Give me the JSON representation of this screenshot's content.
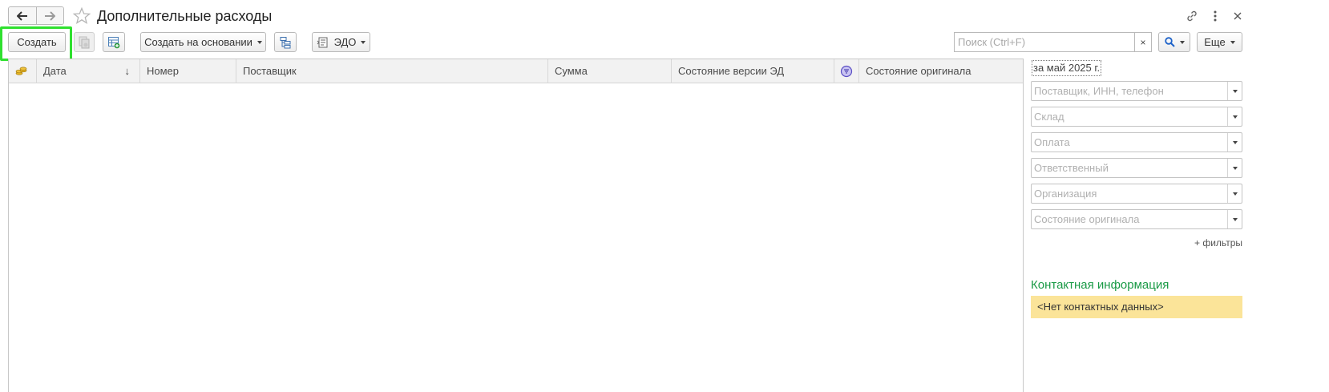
{
  "window": {
    "title": "Дополнительные расходы"
  },
  "toolbar": {
    "create_label": "Создать",
    "create_based_label": "Создать на основании",
    "edo_label": "ЭДО",
    "search_placeholder": "Поиск (Ctrl+F)",
    "search_clear": "×",
    "more_label": "Еще"
  },
  "table": {
    "columns": [
      "Дата",
      "Номер",
      "Поставщик",
      "Сумма",
      "Состояние версии ЭД",
      "Состояние оригинала"
    ],
    "sort_indicator": "↓",
    "rows": []
  },
  "panel": {
    "period": "за май 2025 г.",
    "filters": [
      {
        "placeholder": "Поставщик, ИНН, телефон"
      },
      {
        "placeholder": "Склад"
      },
      {
        "placeholder": "Оплата"
      },
      {
        "placeholder": "Ответственный"
      },
      {
        "placeholder": "Организация"
      },
      {
        "placeholder": "Состояние оригинала"
      }
    ],
    "more_filters": "+ фильтры",
    "contact_title": "Контактная информация",
    "contact_value": "<Нет контактных данных>"
  },
  "colors": {
    "highlight": "#2fe02f",
    "contact_title": "#1a9a46",
    "contact_bg": "#fbe499",
    "search_icon": "#1e63c9"
  },
  "icons": [
    "back-arrow-icon",
    "forward-arrow-icon",
    "star-icon",
    "link-icon",
    "more-vertical-icon",
    "close-icon",
    "copy-document-icon",
    "table-add-icon",
    "hierarchy-icon",
    "edo-icon",
    "search-icon",
    "coins-icon",
    "filter-circle-icon"
  ]
}
